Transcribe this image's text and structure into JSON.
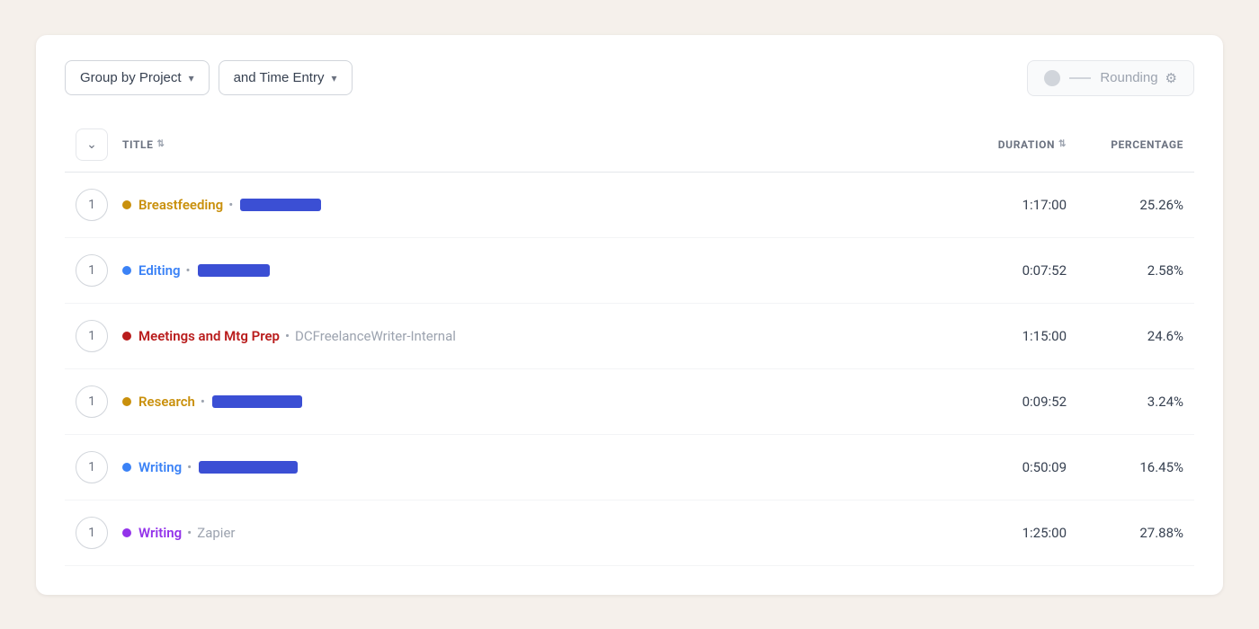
{
  "toolbar": {
    "group_by_label": "Group by Project",
    "time_entry_label": "and Time Entry",
    "rounding_label": "Rounding"
  },
  "table": {
    "header": {
      "title_label": "TITLE",
      "duration_label": "DURATION",
      "percentage_label": "PERCENTAGE"
    },
    "rows": [
      {
        "number": "1",
        "dot_color": "#c9900c",
        "project_name": "Breastfeeding",
        "has_client": true,
        "client_name": "[redacted]",
        "redacted": true,
        "duration": "1:17:00",
        "percentage": "25.26%"
      },
      {
        "number": "1",
        "dot_color": "#3b82f6",
        "project_name": "Editing",
        "has_client": true,
        "client_name": "[redacted]",
        "redacted": true,
        "duration": "0:07:52",
        "percentage": "2.58%"
      },
      {
        "number": "1",
        "dot_color": "#b91c1c",
        "project_name": "Meetings and Mtg Prep",
        "has_client": true,
        "client_name": "DCFreelanceWriter-Internal",
        "redacted": false,
        "duration": "1:15:00",
        "percentage": "24.6%"
      },
      {
        "number": "1",
        "dot_color": "#c9900c",
        "project_name": "Research",
        "has_client": true,
        "client_name": "[redacted]",
        "redacted": true,
        "duration": "0:09:52",
        "percentage": "3.24%"
      },
      {
        "number": "1",
        "dot_color": "#3b82f6",
        "project_name": "Writing",
        "has_client": true,
        "client_name": "[redacted]",
        "redacted": true,
        "duration": "0:50:09",
        "percentage": "16.45%"
      },
      {
        "number": "1",
        "dot_color": "#9333ea",
        "project_name": "Writing",
        "has_client": true,
        "client_name": "Zapier",
        "redacted": false,
        "duration": "1:25:00",
        "percentage": "27.88%"
      }
    ]
  }
}
